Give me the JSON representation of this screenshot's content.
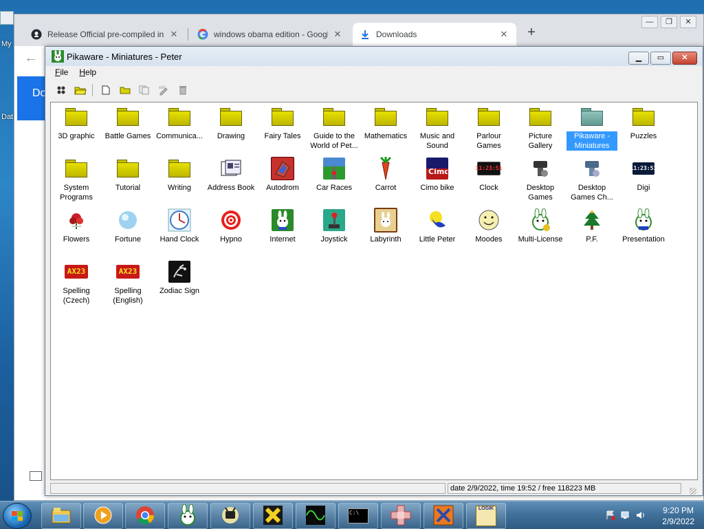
{
  "desktop": {
    "labels": [
      "My",
      "Dat"
    ]
  },
  "browser": {
    "tabs": [
      {
        "title": "Release Official pre-compiled ins",
        "icon": "github-icon"
      },
      {
        "title": "windows obama edition - Google",
        "icon": "google-icon"
      },
      {
        "title": "Downloads",
        "icon": "download-icon",
        "active": true
      }
    ],
    "new_tab": "+",
    "page_header": "Do"
  },
  "app": {
    "title": "Pikaware - Miniatures - Peter",
    "menu": [
      {
        "label": "File",
        "key": "F"
      },
      {
        "label": "Help",
        "key": "H"
      }
    ],
    "toolbar": [
      "run-icon",
      "open-folder-icon",
      "new-file-icon",
      "new-folder-icon",
      "copy-icon",
      "edit-icon",
      "delete-icon"
    ],
    "items": [
      {
        "label": "3D graphic",
        "type": "folder"
      },
      {
        "label": "Battle Games",
        "type": "folder"
      },
      {
        "label": "Communica...",
        "type": "folder"
      },
      {
        "label": "Drawing",
        "type": "folder"
      },
      {
        "label": "Fairy Tales",
        "type": "folder"
      },
      {
        "label": "Guide to the World of Pet...",
        "type": "folder"
      },
      {
        "label": "Mathematics",
        "type": "folder"
      },
      {
        "label": "Music and Sound",
        "type": "folder"
      },
      {
        "label": "Parlour Games",
        "type": "folder"
      },
      {
        "label": "Picture Gallery",
        "type": "folder"
      },
      {
        "label": "Pikaware - Miniatures",
        "type": "folder-teal",
        "selected": true
      },
      {
        "label": "Puzzles",
        "type": "folder"
      },
      {
        "label": "System Programs",
        "type": "folder"
      },
      {
        "label": "Tutorial",
        "type": "folder"
      },
      {
        "label": "Writing",
        "type": "folder"
      },
      {
        "label": "Address Book",
        "type": "address-book"
      },
      {
        "label": "Autodrom",
        "type": "autodrom"
      },
      {
        "label": "Car Races",
        "type": "car-races"
      },
      {
        "label": "Carrot",
        "type": "carrot"
      },
      {
        "label": "Cimo bike",
        "type": "cimo-bike"
      },
      {
        "label": "Clock",
        "type": "digital-clock"
      },
      {
        "label": "Desktop Games",
        "type": "desktop-games"
      },
      {
        "label": "Desktop Games Ch...",
        "type": "desktop-games-ch"
      },
      {
        "label": "Digi",
        "type": "digi"
      },
      {
        "label": "Flowers",
        "type": "flowers"
      },
      {
        "label": "Fortune",
        "type": "fortune"
      },
      {
        "label": "Hand Clock",
        "type": "hand-clock"
      },
      {
        "label": "Hypno",
        "type": "hypno"
      },
      {
        "label": "Internet",
        "type": "internet"
      },
      {
        "label": "Joystick",
        "type": "joystick"
      },
      {
        "label": "Labyrinth",
        "type": "labyrinth"
      },
      {
        "label": "Little Peter",
        "type": "little-peter"
      },
      {
        "label": "Moodes",
        "type": "moodes"
      },
      {
        "label": "Multi-License",
        "type": "multi-license"
      },
      {
        "label": "P.F.",
        "type": "pf"
      },
      {
        "label": "Presentation",
        "type": "presentation"
      },
      {
        "label": "Spelling (Czech)",
        "type": "spelling"
      },
      {
        "label": "Spelling (English)",
        "type": "spelling"
      },
      {
        "label": "Zodiac Sign",
        "type": "zodiac"
      }
    ],
    "icon_text": {
      "clock": "11:23:51",
      "digi": "11:23:51",
      "spelling": "AX23"
    },
    "status": "date 2/9/2022, time 19:52 / free 118223 MB"
  },
  "taskbar": {
    "apps": [
      "explorer-icon",
      "media-player-icon",
      "chrome-icon",
      "pikaware-icon",
      "tv-icon",
      "x-game-icon",
      "oscilloscope-icon",
      "cmd-icon",
      "cross-puzzle-icon",
      "x-box-icon",
      "logik-icon"
    ],
    "logik_label": "LOGIK",
    "cmd_label": "C:\\",
    "clock": {
      "time": "9:20 PM",
      "date": "2/9/2022"
    }
  },
  "colors": {
    "selection": "#3399ff",
    "folder": "#d8d200",
    "taskbar": "#3f6f98",
    "chrome_accent": "#1a73e8"
  }
}
